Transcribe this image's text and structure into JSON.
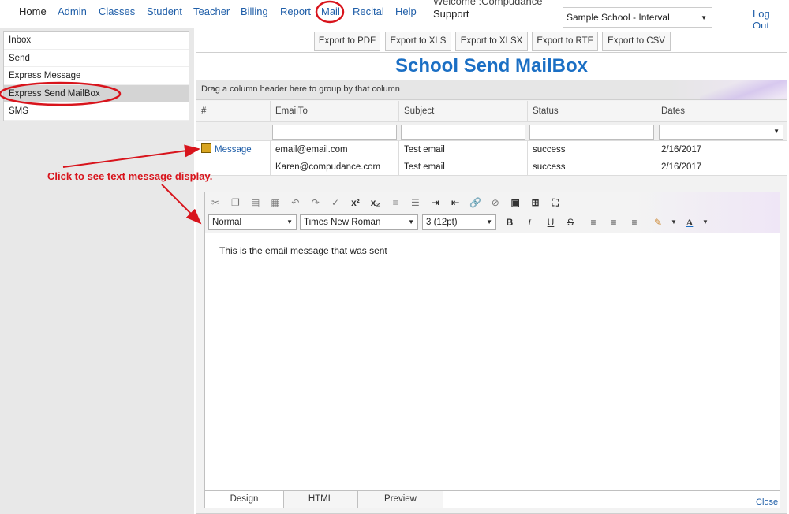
{
  "nav": {
    "items": [
      "Home",
      "Admin",
      "Classes",
      "Student",
      "Teacher",
      "Billing",
      "Report",
      "Mail",
      "Recital",
      "Help"
    ],
    "welcome": "Welcome :Compudance",
    "support": "Support",
    "school": "Sample School - Interval",
    "logout": "Log Out"
  },
  "sidebar": {
    "items": [
      "Inbox",
      "Send",
      "Express Message",
      "Express Send MailBox",
      "SMS"
    ]
  },
  "exports": [
    "Export to PDF",
    "Export to XLS",
    "Export to XLSX",
    "Export to RTF",
    "Export to CSV"
  ],
  "page_title": "School Send MailBox",
  "group_hint": "Drag a column header here to group by that column",
  "grid": {
    "columns": [
      "#",
      "EmailTo",
      "Subject",
      "Status",
      "Dates"
    ],
    "rows": [
      {
        "link": "Message",
        "email": "email@email.com",
        "subject": "Test email",
        "status": "success",
        "date": "2/16/2017"
      },
      {
        "link": "",
        "email": "Karen@compudance.com",
        "subject": "Test email",
        "status": "success",
        "date": "2/16/2017"
      }
    ]
  },
  "editor": {
    "format": "Normal",
    "font": "Times New Roman",
    "size": "3 (12pt)",
    "body": "This is the email message that was sent",
    "tabs": [
      "Design",
      "HTML",
      "Preview"
    ]
  },
  "close": "Close",
  "annotation": "Click to see text message display.",
  "colors": {
    "accent": "#1b6fc4",
    "link": "#1f5ea8",
    "annotation": "#d8141c"
  }
}
